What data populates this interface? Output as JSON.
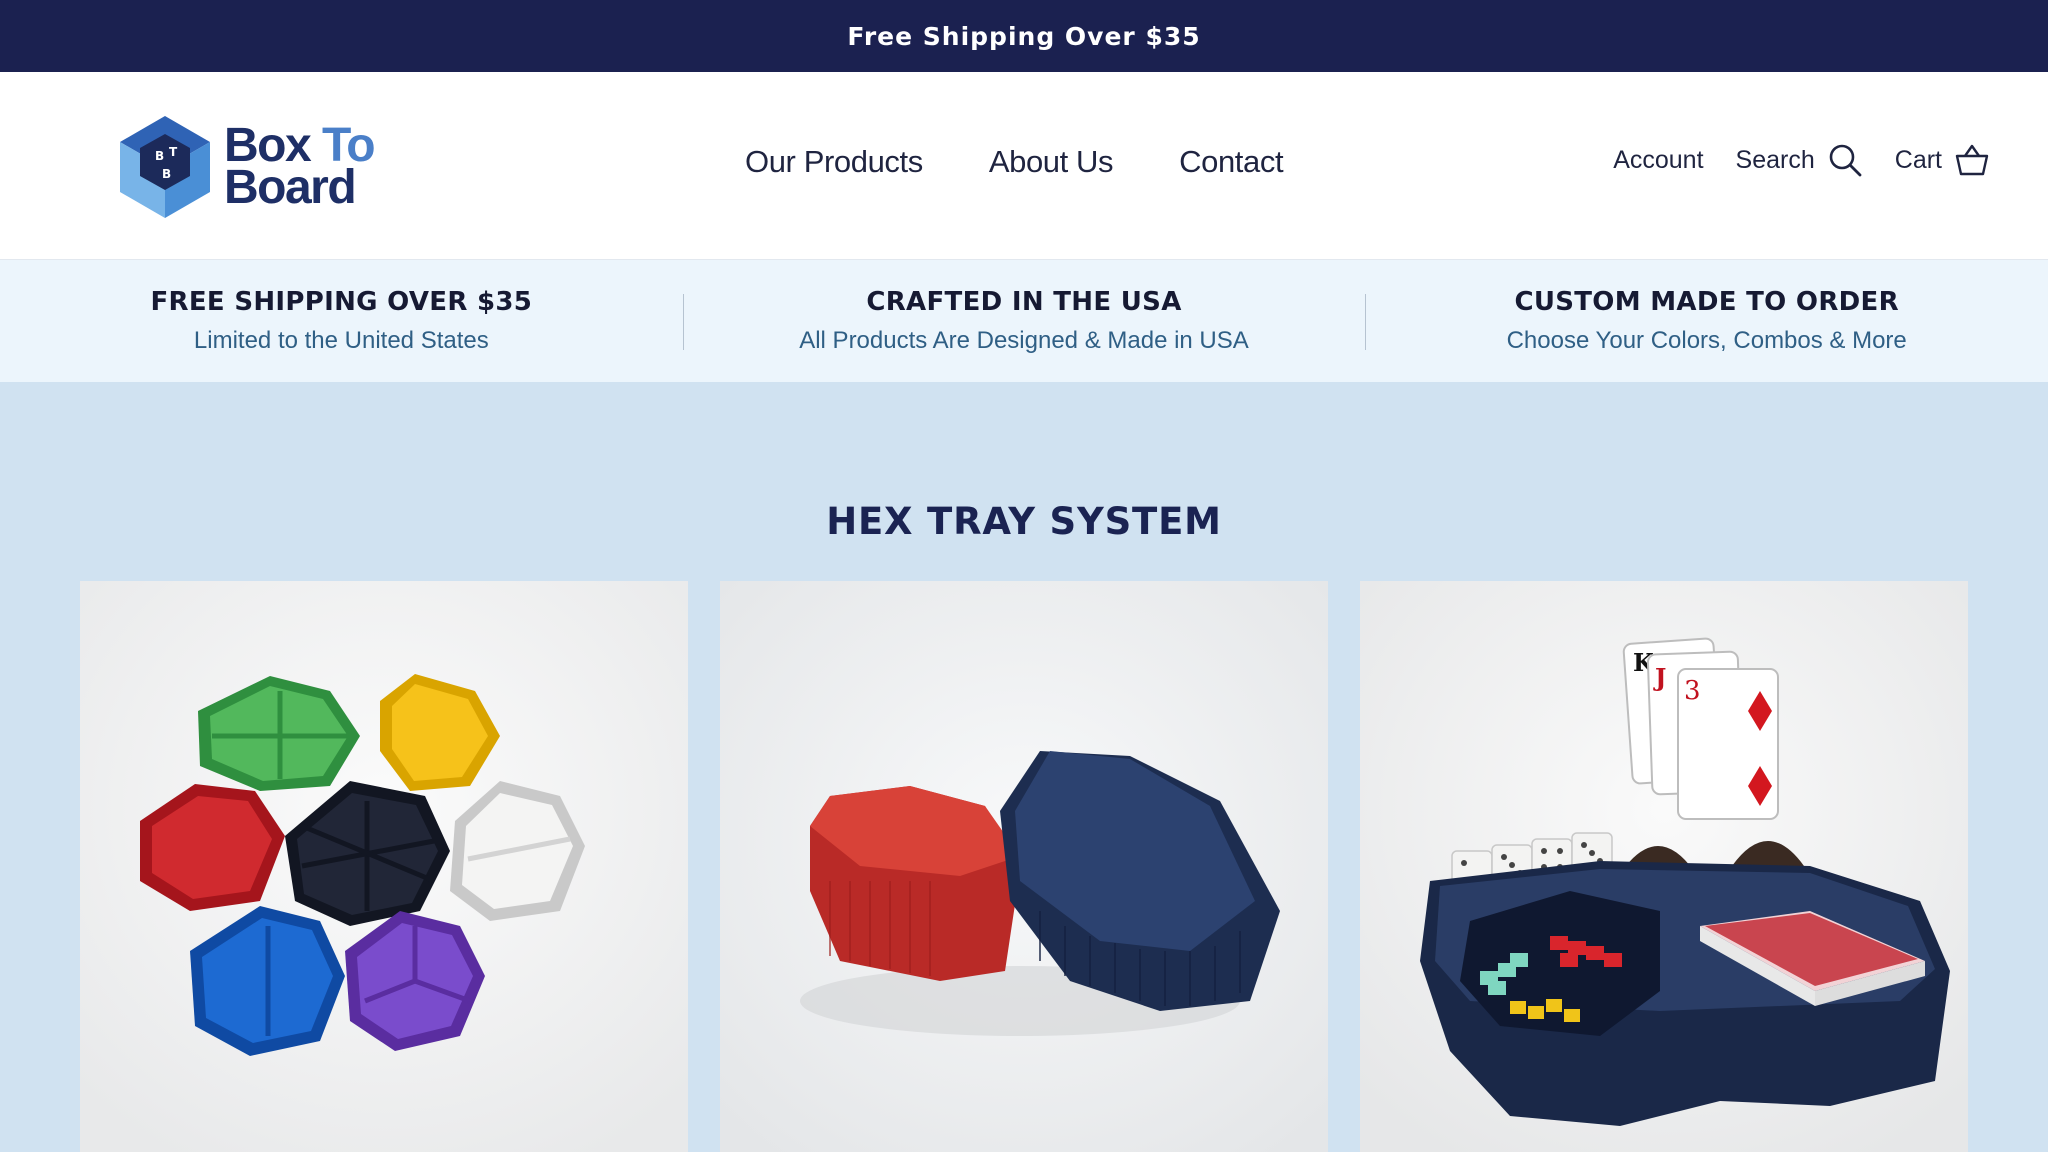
{
  "announcement": {
    "text": "Free Shipping Over $35"
  },
  "header": {
    "logo": {
      "word1": "Box",
      "word2": "To",
      "word3": "Board",
      "mark_letters": [
        "B",
        "T",
        "B"
      ]
    },
    "nav": [
      {
        "label": "Our Products"
      },
      {
        "label": "About Us"
      },
      {
        "label": "Contact"
      }
    ],
    "utility": {
      "account_label": "Account",
      "search_label": "Search",
      "cart_label": "Cart",
      "search_icon": "search-icon",
      "cart_icon": "basket-icon"
    }
  },
  "features": [
    {
      "title": "FREE SHIPPING OVER $35",
      "subtitle": "Limited to the United States"
    },
    {
      "title": "CRAFTED IN THE USA",
      "subtitle": "All Products Are Designed & Made in USA"
    },
    {
      "title": "CUSTOM MADE TO ORDER",
      "subtitle": "Choose Your Colors, Combos & More"
    }
  ],
  "section": {
    "title": "HEX TRAY SYSTEM"
  },
  "cards": [
    {
      "image": "seven-color-hex-trays"
    },
    {
      "image": "red-and-navy-hex-trays"
    },
    {
      "image": "card-game-hex-tray-set"
    }
  ],
  "playing_cards": [
    "K",
    "J",
    "3"
  ],
  "colors": {
    "announcement_bg": "#1b2150",
    "features_bg": "#ecf5fc",
    "page_bg": "#d0e2f1",
    "brand_navy": "#1e2f66",
    "brand_blue": "#4a7fc8"
  }
}
